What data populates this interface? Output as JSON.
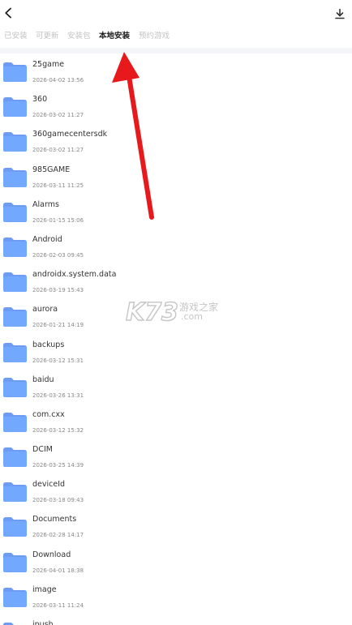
{
  "tabs": [
    {
      "label": "已安装",
      "active": false
    },
    {
      "label": "可更新",
      "active": false
    },
    {
      "label": "安装包",
      "active": false
    },
    {
      "label": "本地安装",
      "active": true
    },
    {
      "label": "预约游戏",
      "active": false
    }
  ],
  "files": [
    {
      "name": "25game",
      "date": "2026-04-02 13:56"
    },
    {
      "name": "360",
      "date": "2026-03-02 11:27"
    },
    {
      "name": "360gamecentersdk",
      "date": "2026-03-02 11:27"
    },
    {
      "name": "985GAME",
      "date": "2026-03-11 11:25"
    },
    {
      "name": "Alarms",
      "date": "2026-01-15 15:06"
    },
    {
      "name": "Android",
      "date": "2026-02-03 09:45"
    },
    {
      "name": "androidx.system.data",
      "date": "2026-03-19 15:43"
    },
    {
      "name": "aurora",
      "date": "2026-01-21 14:19"
    },
    {
      "name": "backups",
      "date": "2026-03-12 15:31"
    },
    {
      "name": "baidu",
      "date": "2026-03-26 13:31"
    },
    {
      "name": "com.cxx",
      "date": "2026-03-12 15:32"
    },
    {
      "name": "DCIM",
      "date": "2026-03-25 14:39"
    },
    {
      "name": "deviceId",
      "date": "2026-03-18 09:43"
    },
    {
      "name": "Documents",
      "date": "2026-02-28 14:17"
    },
    {
      "name": "Download",
      "date": "2026-04-01 18:38"
    },
    {
      "name": "image",
      "date": "2026-03-11 11:24"
    },
    {
      "name": "jpush",
      "date": ""
    }
  ],
  "watermark": {
    "logo": "K73",
    "text": "游戏之家",
    "domain": ".com"
  },
  "colors": {
    "folder": "#73a8ff",
    "folder_tab": "#6d9cf2",
    "arrow": "#e8191c",
    "active_tab": "#1a1a1a",
    "inactive_tab": "#c3c3c3",
    "divider": "#f4f5f8"
  },
  "icons": {
    "back": "back-chevron-icon",
    "download": "download-icon",
    "folder": "folder-icon"
  }
}
